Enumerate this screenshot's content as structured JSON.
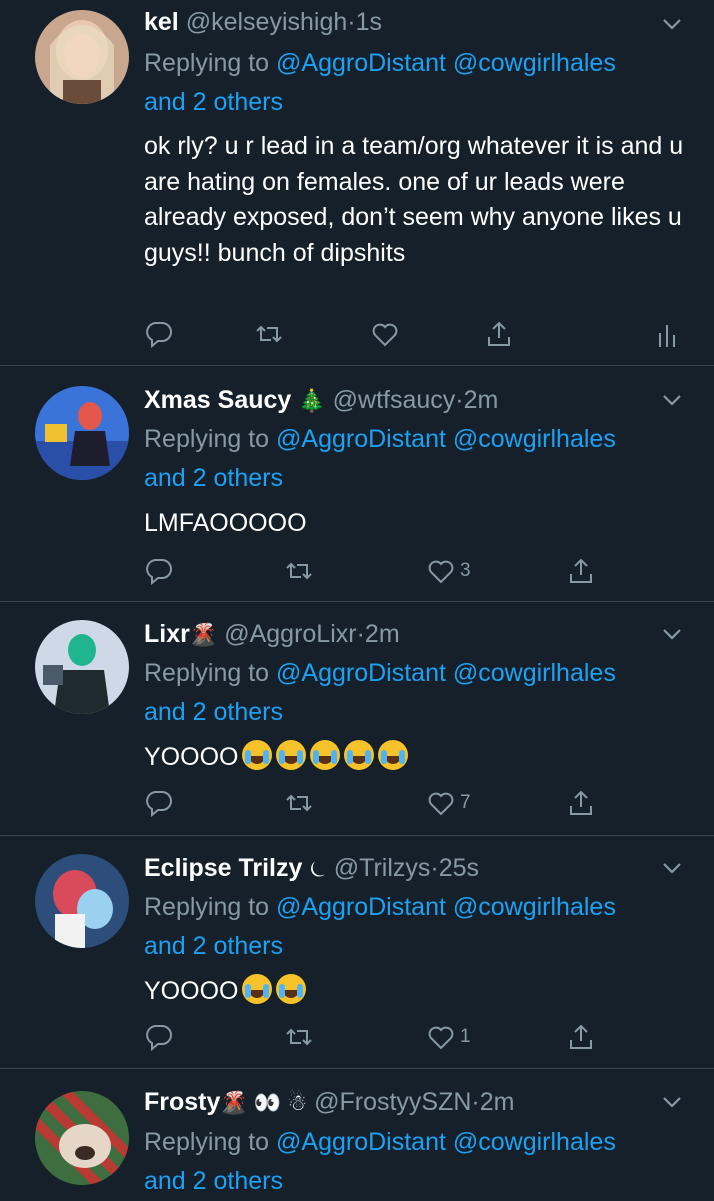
{
  "colors": {
    "background": "#15202b",
    "link": "#1da1f2",
    "muted": "#8899a6",
    "divider": "#38444d"
  },
  "tweets": [
    {
      "name": "kel",
      "name_emoji": "",
      "handle": "@kelseyishigh",
      "time": "1s",
      "replying_label": "Replying to",
      "replying_users": "@AggroDistant @cowgirlhales",
      "replying_others": "and 2 others",
      "text": "ok rly? u r lead in a team/org whatever it is and u are hating on females. one of ur leads were already exposed, don’t seem why anyone likes u guys!! bunch of dipshits",
      "likes": "",
      "icons": [
        "reply-icon",
        "retweet-icon",
        "like-icon",
        "share-icon",
        "analytics-icon"
      ]
    },
    {
      "name": "Xmas Saucy",
      "name_emoji": "🎄",
      "handle": "@wtfsaucy",
      "time": "2m",
      "replying_label": "Replying to",
      "replying_users": "@AggroDistant @cowgirlhales",
      "replying_others": "and 2 others",
      "text": "LMFAOOOOO",
      "likes": "3",
      "icons": [
        "reply-icon",
        "retweet-icon",
        "like-icon",
        "share-icon"
      ]
    },
    {
      "name": "Lixr",
      "name_emoji": "🌋",
      "handle": "@AggroLixr",
      "time": "2m",
      "replying_label": "Replying to",
      "replying_users": "@AggroDistant @cowgirlhales",
      "replying_others": "and 2 others",
      "text": "YOOOO",
      "text_emoji": [
        "loudly-crying-face",
        "loudly-crying-face",
        "loudly-crying-face",
        "tears-of-joy-face",
        "tears-of-joy-face"
      ],
      "likes": "7",
      "icons": [
        "reply-icon",
        "retweet-icon",
        "like-icon",
        "share-icon"
      ]
    },
    {
      "name": "Eclipse Trilzy",
      "name_emoji": "⏾",
      "handle": "@Trilzys",
      "time": "25s",
      "replying_label": "Replying to",
      "replying_users": "@AggroDistant @cowgirlhales",
      "replying_others": "and 2 others",
      "text": "YOOOO",
      "text_emoji": [
        "tears-of-joy-face",
        "tears-of-joy-face"
      ],
      "likes": "1",
      "icons": [
        "reply-icon",
        "retweet-icon",
        "like-icon",
        "share-icon"
      ]
    },
    {
      "name": "Frosty",
      "name_emoji": "🌋 👀 ☃",
      "handle": "@FrostyySZN",
      "time": "2m",
      "replying_label": "Replying to",
      "replying_users": "@AggroDistant @cowgirlhales",
      "replying_others": "and 2 others",
      "text": "",
      "likes": "",
      "icons": []
    }
  ],
  "separator": "·"
}
